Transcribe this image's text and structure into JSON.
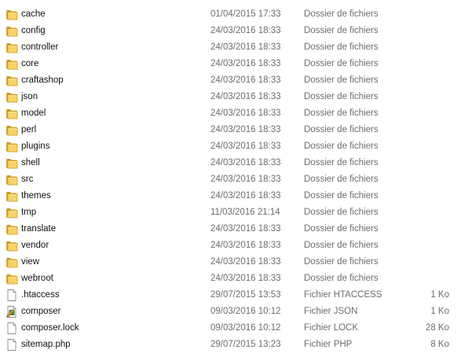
{
  "files": [
    {
      "name": "cache",
      "modified": "01/04/2015 17:33",
      "type": "Dossier de fichiers",
      "size": "",
      "icon": "folder-icon"
    },
    {
      "name": "config",
      "modified": "24/03/2016 18:33",
      "type": "Dossier de fichiers",
      "size": "",
      "icon": "folder-icon"
    },
    {
      "name": "controller",
      "modified": "24/03/2016 18:33",
      "type": "Dossier de fichiers",
      "size": "",
      "icon": "folder-icon"
    },
    {
      "name": "core",
      "modified": "24/03/2016 18:33",
      "type": "Dossier de fichiers",
      "size": "",
      "icon": "folder-icon"
    },
    {
      "name": "craftashop",
      "modified": "24/03/2016 18:33",
      "type": "Dossier de fichiers",
      "size": "",
      "icon": "folder-icon"
    },
    {
      "name": "json",
      "modified": "24/03/2016 18:33",
      "type": "Dossier de fichiers",
      "size": "",
      "icon": "folder-icon"
    },
    {
      "name": "model",
      "modified": "24/03/2016 18:33",
      "type": "Dossier de fichiers",
      "size": "",
      "icon": "folder-icon"
    },
    {
      "name": "perl",
      "modified": "24/03/2016 18:33",
      "type": "Dossier de fichiers",
      "size": "",
      "icon": "folder-icon"
    },
    {
      "name": "plugins",
      "modified": "24/03/2016 18:33",
      "type": "Dossier de fichiers",
      "size": "",
      "icon": "folder-icon"
    },
    {
      "name": "shell",
      "modified": "24/03/2016 18:33",
      "type": "Dossier de fichiers",
      "size": "",
      "icon": "folder-icon"
    },
    {
      "name": "src",
      "modified": "24/03/2016 18:33",
      "type": "Dossier de fichiers",
      "size": "",
      "icon": "folder-icon"
    },
    {
      "name": "themes",
      "modified": "24/03/2016 18:33",
      "type": "Dossier de fichiers",
      "size": "",
      "icon": "folder-icon"
    },
    {
      "name": "tmp",
      "modified": "11/03/2016 21:14",
      "type": "Dossier de fichiers",
      "size": "",
      "icon": "folder-icon"
    },
    {
      "name": "translate",
      "modified": "24/03/2016 18:33",
      "type": "Dossier de fichiers",
      "size": "",
      "icon": "folder-icon"
    },
    {
      "name": "vendor",
      "modified": "24/03/2016 18:33",
      "type": "Dossier de fichiers",
      "size": "",
      "icon": "folder-icon"
    },
    {
      "name": "view",
      "modified": "24/03/2016 18:33",
      "type": "Dossier de fichiers",
      "size": "",
      "icon": "folder-icon"
    },
    {
      "name": "webroot",
      "modified": "24/03/2016 18:33",
      "type": "Dossier de fichiers",
      "size": "",
      "icon": "folder-icon"
    },
    {
      "name": ".htaccess",
      "modified": "29/07/2015 13:53",
      "type": "Fichier HTACCESS",
      "size": "1 Ko",
      "icon": "file-icon"
    },
    {
      "name": "composer",
      "modified": "09/03/2016 10:12",
      "type": "Fichier JSON",
      "size": "1 Ko",
      "icon": "json-file-icon"
    },
    {
      "name": "composer.lock",
      "modified": "09/03/2016 10:12",
      "type": "Fichier LOCK",
      "size": "28 Ko",
      "icon": "file-icon"
    },
    {
      "name": "sitemap.php",
      "modified": "29/07/2015 13:23",
      "type": "Fichier PHP",
      "size": "8 Ko",
      "icon": "file-icon"
    }
  ]
}
